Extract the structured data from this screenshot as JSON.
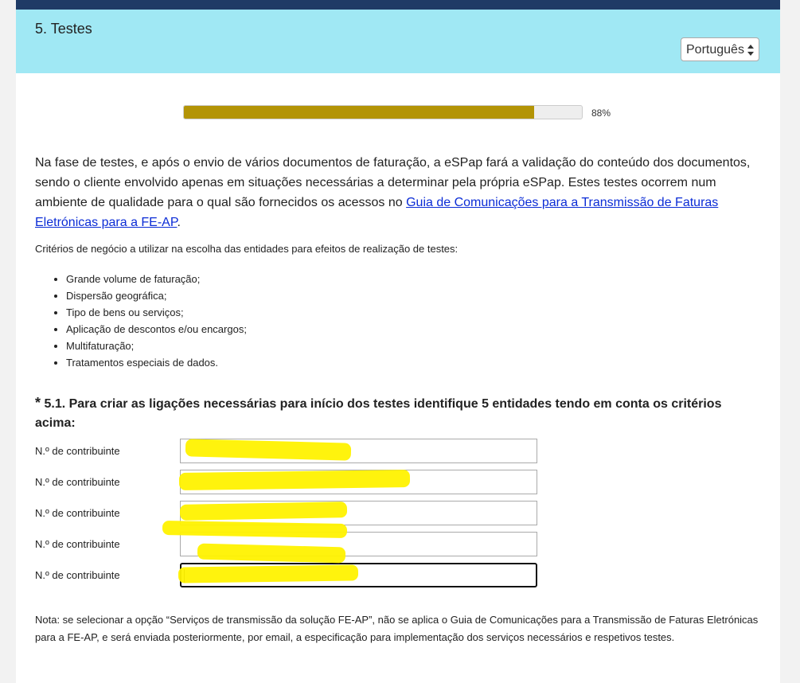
{
  "header": {
    "title": "5. Testes",
    "language": "Português"
  },
  "progress": {
    "value": 0.88,
    "label": "88%"
  },
  "intro": {
    "text_before": "Na fase de testes, e após o envio de vários documentos de faturação, a eSPap fará a validação do conteúdo dos documentos, sendo o cliente envolvido apenas em situações necessárias a determinar pela própria eSPap. Estes testes ocorrem num ambiente de qualidade para o qual são fornecidos os acessos no ",
    "link": "Guia de Comunicações para a Transmissão de Faturas Eletrónicas para a FE-AP",
    "text_after": "."
  },
  "criteria": {
    "heading": "Critérios de negócio a utilizar na escolha das entidades para efeitos de realização de testes:",
    "items": [
      "Grande volume de faturação;",
      "Dispersão geográfica;",
      "Tipo de bens ou serviços;",
      "Aplicação de descontos e/ou encargos;",
      "Multifaturação;",
      "Tratamentos especiais de dados."
    ]
  },
  "question": {
    "required_mark": "*",
    "text": "5.1. Para criar as ligações necessárias para início dos testes identifique 5 entidades tendo em conta os critérios acima:"
  },
  "fields": [
    {
      "label": "N.º de contribuinte",
      "value": ""
    },
    {
      "label": "N.º de contribuinte",
      "value": ""
    },
    {
      "label": "N.º de contribuinte",
      "value": ""
    },
    {
      "label": "N.º de contribuinte",
      "value": ""
    },
    {
      "label": "N.º de contribuinte",
      "value": ""
    }
  ],
  "note": "Nota: se selecionar a opção “Serviços de transmissão da solução FE-AP”, não se aplica o Guia de Comunicações para a Transmissão de Faturas Eletrónicas para a FE-AP, e será enviada posteriormente, por email, a especificação para implementação dos serviços necessários e respetivos testes.",
  "colors": {
    "header_bar": "#1f3b66",
    "header_bg": "#a0e8f4",
    "progress_fill": "#b39406",
    "link": "#0b2cd6",
    "highlight": "#fff200"
  }
}
